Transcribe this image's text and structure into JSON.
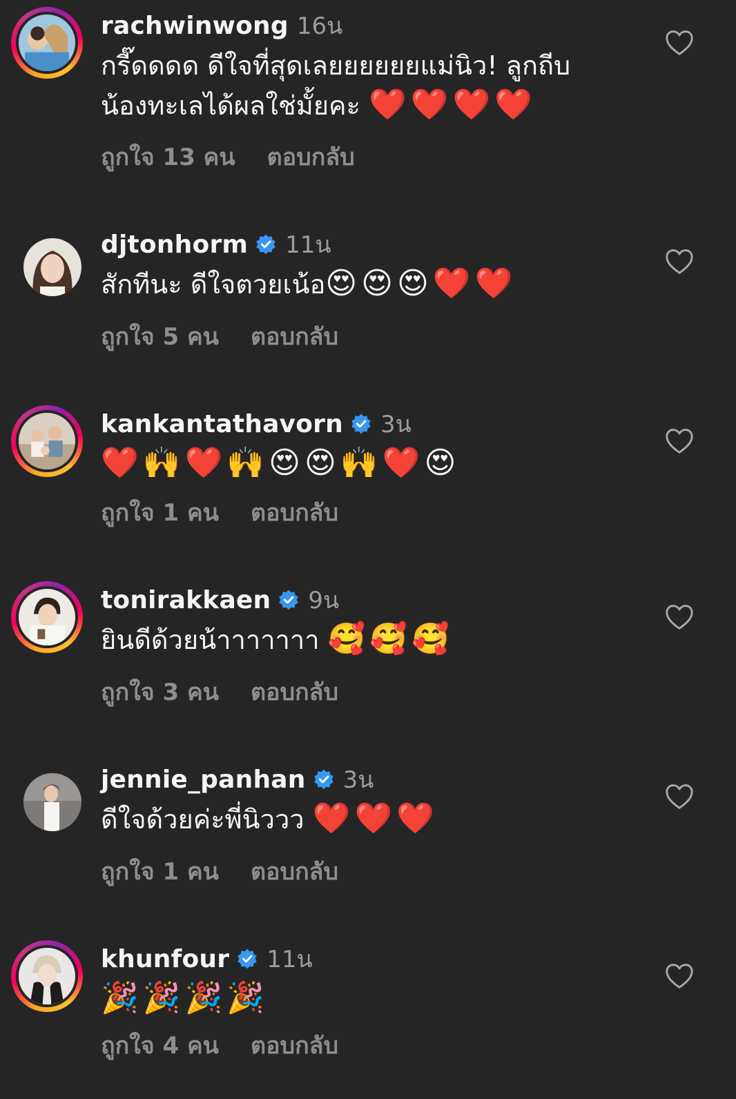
{
  "comments": [
    {
      "username": "rachwinwong",
      "verified": false,
      "time": "16น",
      "text": "กรี๊ดดดด ดีใจที่สุดเลยยยยยยแม่นิว! ลูกถีบ\nน้องทะเลได้ผลใช่มั้ยคะ ",
      "emoji": "❤️❤️❤️❤️",
      "likes": "ถูกใจ 13 คน",
      "reply": "ตอบกลับ"
    },
    {
      "username": "djtonhorm",
      "verified": true,
      "time": "11น",
      "text": "สักทีนะ ดีใจตวยเน้อ",
      "emoji": "😍😍😍❤️❤️",
      "likes": "ถูกใจ 5 คน",
      "reply": "ตอบกลับ"
    },
    {
      "username": "kankantathavorn",
      "verified": true,
      "time": "3น",
      "text": "",
      "emoji": "❤️🙌❤️🙌😍😍🙌❤️😍",
      "likes": "ถูกใจ 1 คน",
      "reply": "ตอบกลับ"
    },
    {
      "username": "tonirakkaen",
      "verified": true,
      "time": "9น",
      "text": "ยินดีด้วยน้าาาาาาา ",
      "emoji": "🥰🥰🥰",
      "likes": "ถูกใจ 3 คน",
      "reply": "ตอบกลับ"
    },
    {
      "username": "jennie_panhan",
      "verified": true,
      "time": "3น",
      "text": "ดีใจด้วยค่ะพี่นิววว ",
      "emoji": "❤️❤️❤️",
      "likes": "ถูกใจ 1 คน",
      "reply": "ตอบกลับ"
    },
    {
      "username": "khunfour",
      "verified": true,
      "time": "11น",
      "text": "",
      "emoji": "🎉🎉🎉🎉",
      "likes": "ถูกใจ 4 คน",
      "reply": "ตอบกลับ"
    }
  ],
  "colors": {
    "background": "#252526",
    "text": "#f5f5f5",
    "secondary": "#8e8e8e",
    "verified": "#3897f0"
  }
}
